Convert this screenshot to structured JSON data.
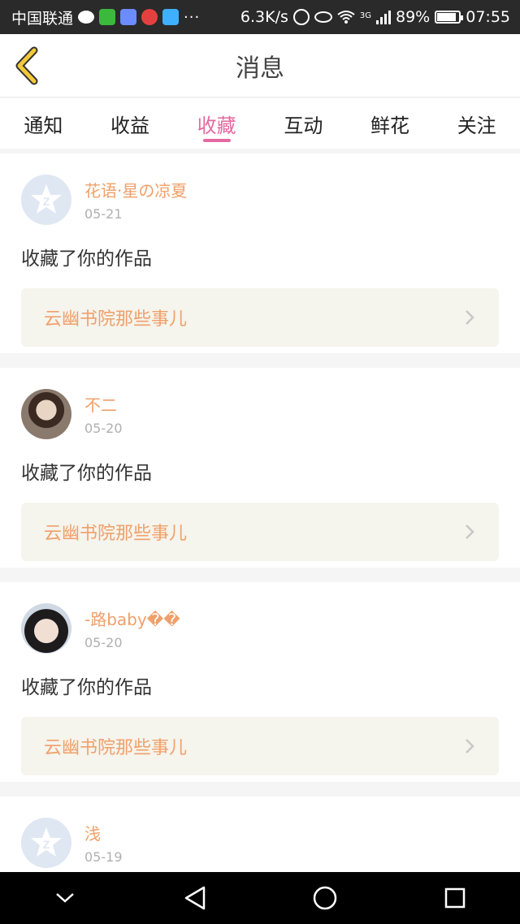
{
  "status_bar": {
    "carrier": "中国联通",
    "net_speed": "6.3K/s",
    "signal_type": "3G",
    "battery_percent": "89%",
    "time": "07:55",
    "icons": [
      "chat-icon",
      "iqiyi-icon",
      "app-icon",
      "music-icon",
      "video-icon",
      "more-dots-icon",
      "data-saver-icon",
      "eye-icon",
      "wifi-icon",
      "signal-icon",
      "battery-icon"
    ]
  },
  "header": {
    "title": "消息",
    "back_icon": "chevron-left-icon"
  },
  "tabs": [
    {
      "label": "通知",
      "active": false
    },
    {
      "label": "收益",
      "active": false
    },
    {
      "label": "收藏",
      "active": true
    },
    {
      "label": "互动",
      "active": false
    },
    {
      "label": "鲜花",
      "active": false
    },
    {
      "label": "关注",
      "active": false
    }
  ],
  "messages": [
    {
      "name": "花语·星の凉夏",
      "date": "05-21",
      "action": "收藏了你的作品",
      "work_title": "云幽书院那些事儿"
    },
    {
      "name": "不二",
      "date": "05-20",
      "action": "收藏了你的作品",
      "work_title": "云幽书院那些事儿"
    },
    {
      "name": "-路baby��",
      "date": "05-20",
      "action": "收藏了你的作品",
      "work_title": "云幽书院那些事儿"
    },
    {
      "name": "浅",
      "date": "05-19"
    }
  ],
  "colors": {
    "accent": "#e36aa0",
    "name_color": "#f0a06a",
    "back_chevron": "#c9a000"
  },
  "nav_bar": {
    "icons": [
      "collapse-icon",
      "back-triangle-icon",
      "home-circle-icon",
      "recents-square-icon"
    ]
  }
}
